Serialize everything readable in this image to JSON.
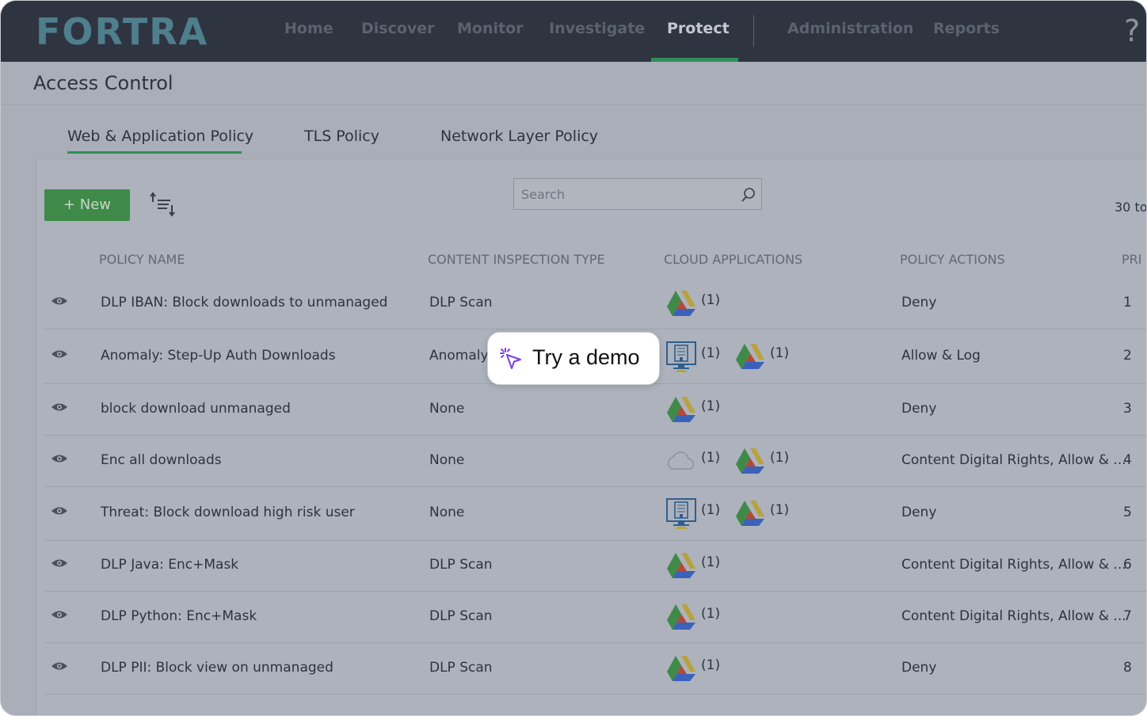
{
  "brand": "FORTRA",
  "nav": {
    "items": [
      "Home",
      "Discover",
      "Monitor",
      "Investigate",
      "Protect",
      "Administration",
      "Reports"
    ],
    "active": "Protect",
    "help": "?"
  },
  "page_title": "Access Control",
  "tabs": [
    "Web & Application Policy",
    "TLS Policy",
    "Network Layer Policy"
  ],
  "toolbar": {
    "new_label": "+ New",
    "search_placeholder": "Search",
    "count_text": "30 to"
  },
  "columns": [
    "POLICY NAME",
    "CONTENT INSPECTION TYPE",
    "CLOUD APPLICATIONS",
    "POLICY ACTIONS",
    "PRI"
  ],
  "rows": [
    {
      "name": "DLP IBAN: Block downloads to unmanaged",
      "type": "DLP Scan",
      "apps": [
        {
          "icon": "google-drive-icon",
          "count": "(1)"
        }
      ],
      "action": "Deny",
      "priority": "1"
    },
    {
      "name": "Anomaly: Step-Up Auth Downloads",
      "type": "Anomaly",
      "apps": [
        {
          "icon": "enterprise-app-icon",
          "count": "(1)"
        },
        {
          "icon": "google-drive-icon",
          "count": "(1)"
        }
      ],
      "action": "Allow & Log",
      "priority": "2"
    },
    {
      "name": "block download unmanaged",
      "type": "None",
      "apps": [
        {
          "icon": "google-drive-icon",
          "count": "(1)"
        }
      ],
      "action": "Deny",
      "priority": "3"
    },
    {
      "name": "Enc all downloads",
      "type": "None",
      "apps": [
        {
          "icon": "cloud-icon",
          "count": "(1)"
        },
        {
          "icon": "google-drive-icon",
          "count": "(1)"
        }
      ],
      "action": "Content Digital Rights, Allow & ...",
      "priority": "4"
    },
    {
      "name": "Threat: Block download high risk user",
      "type": "None",
      "apps": [
        {
          "icon": "enterprise-app-icon",
          "count": "(1)"
        },
        {
          "icon": "google-drive-icon",
          "count": "(1)"
        }
      ],
      "action": "Deny",
      "priority": "5"
    },
    {
      "name": "DLP Java: Enc+Mask",
      "type": "DLP Scan",
      "apps": [
        {
          "icon": "google-drive-icon",
          "count": "(1)"
        }
      ],
      "action": "Content Digital Rights, Allow & ...",
      "priority": "6"
    },
    {
      "name": "DLP Python: Enc+Mask",
      "type": "DLP Scan",
      "apps": [
        {
          "icon": "google-drive-icon",
          "count": "(1)"
        }
      ],
      "action": "Content Digital Rights, Allow & ...",
      "priority": "7"
    },
    {
      "name": "DLP PII: Block view on unmanaged",
      "type": "DLP Scan",
      "apps": [
        {
          "icon": "google-drive-icon",
          "count": "(1)"
        }
      ],
      "action": "Deny",
      "priority": "8"
    }
  ],
  "demo_button": "Try a demo",
  "colors": {
    "accent_green": "#2f8f5a",
    "button_green": "#3f8a49",
    "topbar": "#2e3540",
    "overlay": "#a9aeb8"
  }
}
